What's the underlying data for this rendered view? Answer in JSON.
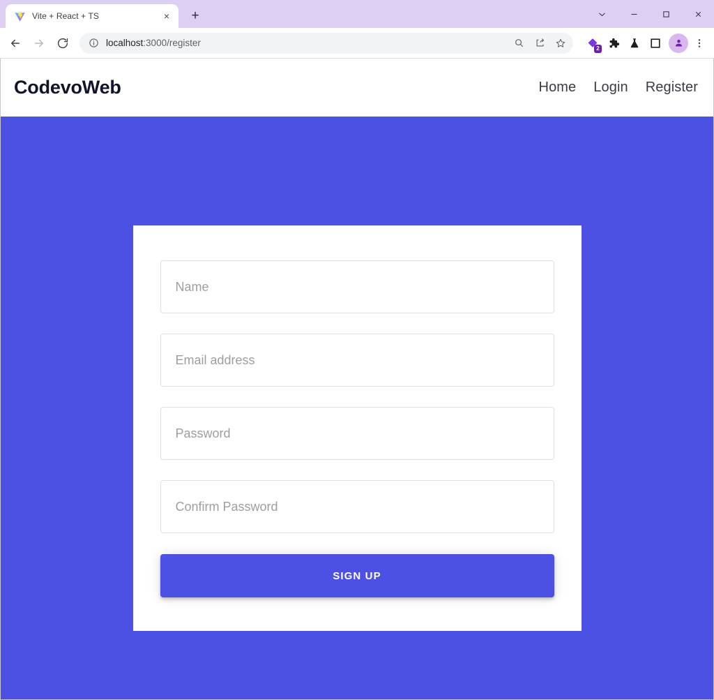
{
  "browser": {
    "tab": {
      "title": "Vite + React + TS",
      "favicon": "vite-logo-icon",
      "close_label": "×"
    },
    "new_tab_label": "+",
    "window_controls": [
      {
        "name": "tab-search-button",
        "glyph": "⌄"
      },
      {
        "name": "minimize-button",
        "glyph": "−"
      },
      {
        "name": "maximize-button",
        "glyph": "□"
      },
      {
        "name": "close-window-button",
        "glyph": "✕"
      }
    ],
    "nav": {
      "back_label": "←",
      "forward_label": "→",
      "reload_label": "⟳"
    },
    "omnibox": {
      "site_info_icon": "info-circle-icon",
      "host": "localhost",
      "path": ":3000/register",
      "full_url": "localhost:3000/register",
      "actions": [
        {
          "name": "zoom-icon"
        },
        {
          "name": "share-icon"
        },
        {
          "name": "bookmark-star-icon"
        }
      ]
    },
    "extensions": [
      {
        "name": "purple-diamond-extension-icon",
        "badge": "2"
      },
      {
        "name": "extensions-puzzle-icon",
        "badge": ""
      },
      {
        "name": "flask-experiment-icon",
        "badge": ""
      },
      {
        "name": "split-view-icon",
        "badge": ""
      }
    ],
    "profile": {
      "name": "profile-avatar",
      "icon": "person-icon"
    },
    "menu": {
      "name": "chrome-menu-button",
      "icon": "three-dots-icon"
    }
  },
  "site": {
    "brand": "CodevoWeb",
    "nav_links": [
      {
        "label": "Home"
      },
      {
        "label": "Login"
      },
      {
        "label": "Register"
      }
    ]
  },
  "form": {
    "fields": [
      {
        "name": "name-input",
        "placeholder": "Name",
        "value": "",
        "type": "text"
      },
      {
        "name": "email-input",
        "placeholder": "Email address",
        "value": "",
        "type": "text"
      },
      {
        "name": "password-input",
        "placeholder": "Password",
        "value": "",
        "type": "password"
      },
      {
        "name": "confirm-password-input",
        "placeholder": "Confirm Password",
        "value": "",
        "type": "password"
      }
    ],
    "submit_label": "SIGN UP"
  },
  "colors": {
    "brand_purple": "#4c51e3",
    "tabstrip_lavender": "#ddcef4",
    "card_white": "#ffffff",
    "placeholder_gray": "#9e9e9e",
    "field_border": "#dfdfdf",
    "badge_purple": "#6b21a8"
  }
}
